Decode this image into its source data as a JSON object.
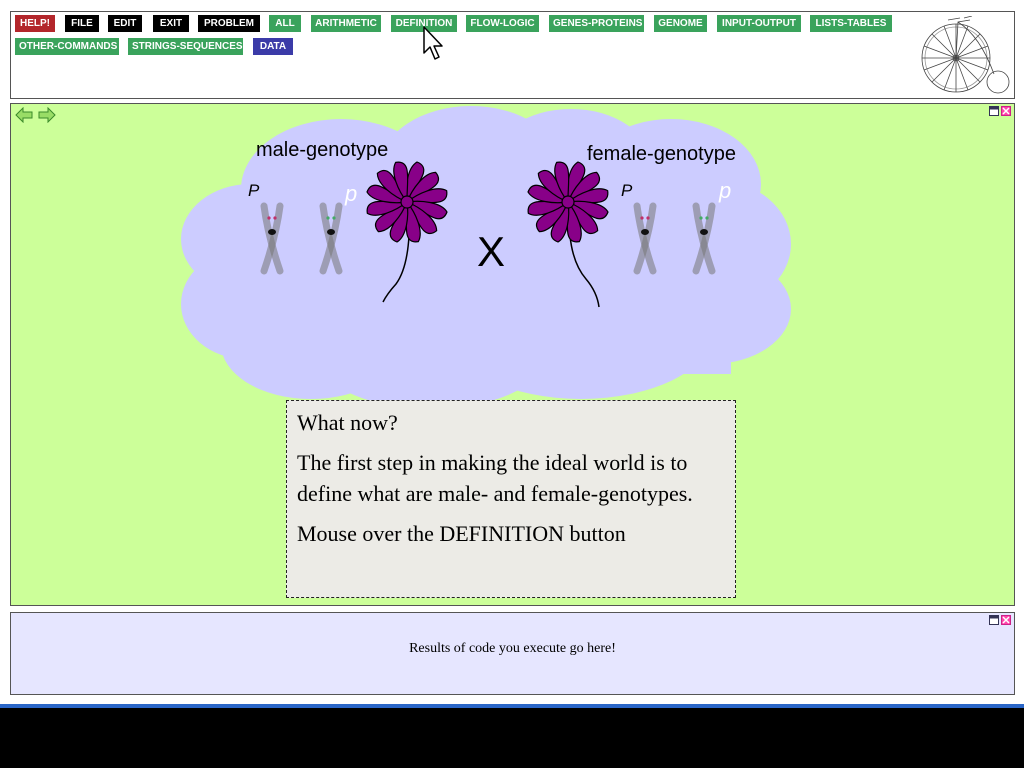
{
  "toolbar": {
    "buttons": [
      {
        "label": "HELP!",
        "style": "red"
      },
      {
        "label": "FILE",
        "style": "black"
      },
      {
        "label": "EDIT",
        "style": "black"
      },
      {
        "label": "EXIT",
        "style": "black"
      },
      {
        "label": "PROBLEM",
        "style": "black"
      },
      {
        "label": "ALL",
        "style": "green"
      },
      {
        "label": "ARITHMETIC",
        "style": "green"
      },
      {
        "label": "DEFINITION",
        "style": "green"
      },
      {
        "label": "FLOW-LOGIC",
        "style": "green"
      },
      {
        "label": "GENES-PROTEINS",
        "style": "green"
      },
      {
        "label": "GENOME",
        "style": "green"
      },
      {
        "label": "INPUT-OUTPUT",
        "style": "green"
      },
      {
        "label": "LISTS-TABLES",
        "style": "green"
      },
      {
        "label": "OTHER-COMMANDS",
        "style": "green"
      },
      {
        "label": "STRINGS-SEQUENCES",
        "style": "green"
      },
      {
        "label": "DATA",
        "style": "blue"
      }
    ]
  },
  "scene": {
    "male_label": "male-genotype",
    "female_label": "female-genotype",
    "cross_symbol": "X",
    "male_alleles": [
      "P",
      "p"
    ],
    "female_alleles": [
      "P",
      "p"
    ]
  },
  "message": {
    "line1": "What now?",
    "line2": "The first step in making the ideal world is to define what are male- and female-genotypes.",
    "line3": "Mouse over the DEFINITION button"
  },
  "results": {
    "text": "Results of code you execute go here!"
  },
  "colors": {
    "main_bg": "#ccff99",
    "cloud": "#ccccff",
    "flower": "#880088",
    "results_bg": "#e6e6ff"
  }
}
